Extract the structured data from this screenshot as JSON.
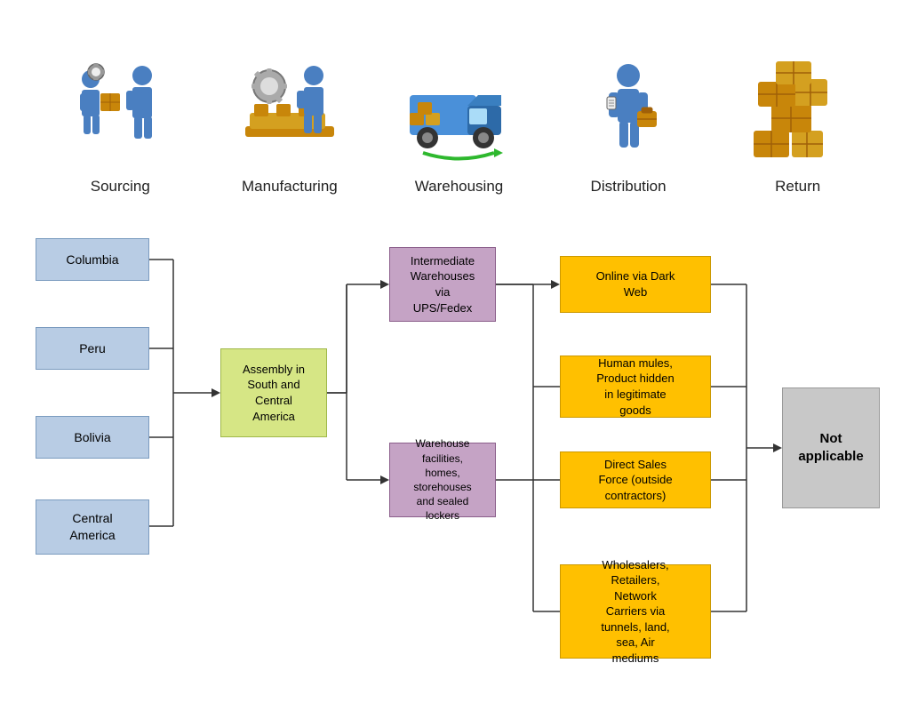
{
  "icons": [
    {
      "id": "sourcing",
      "label": "Sourcing",
      "emoji": "🏭"
    },
    {
      "id": "manufacturing",
      "label": "Manufacturing",
      "emoji": "⚙️"
    },
    {
      "id": "warehousing",
      "label": "Warehousing",
      "emoji": "🚛"
    },
    {
      "id": "distribution",
      "label": "Distribution",
      "emoji": "🧍"
    },
    {
      "id": "return",
      "label": "Return",
      "emoji": "📦"
    }
  ],
  "nodes": {
    "columbia": "Columbia",
    "peru": "Peru",
    "bolivia": "Bolivia",
    "central_america": "Central\nAmerica",
    "assembly": "Assembly in\nSouth and\nCentral\nAmerica",
    "intermediate_wh": "Intermediate\nWarehouses\nvia\nUPS/Fedex",
    "warehouse_fac": "Warehouse\nfacilities,\nhomes,\nstorehouses\nand sealed\nlockers",
    "online_dark_web": "Online via Dark\nWeb",
    "human_mules": "Human mules,\nProduct hidden\nin legitimate\ngoods",
    "direct_sales": "Direct Sales\nForce (outside\ncontractors)",
    "wholesalers": "Wholesalers,\nRetailers,\nNetwork\nCarriers via\ntunnels, land,\nsea, Air\nmediums",
    "not_applicable": "Not\napplicable"
  },
  "colors": {
    "blue": "#b8cce4",
    "blue_border": "#7a9bbf",
    "yellow_green": "#d6e685",
    "yellow_green_border": "#a0b84a",
    "purple": "#c5a3c5",
    "purple_border": "#8b5e8b",
    "orange": "#ffc000",
    "orange_border": "#cc9900",
    "gray": "#c8c8c8",
    "gray_border": "#999999"
  }
}
